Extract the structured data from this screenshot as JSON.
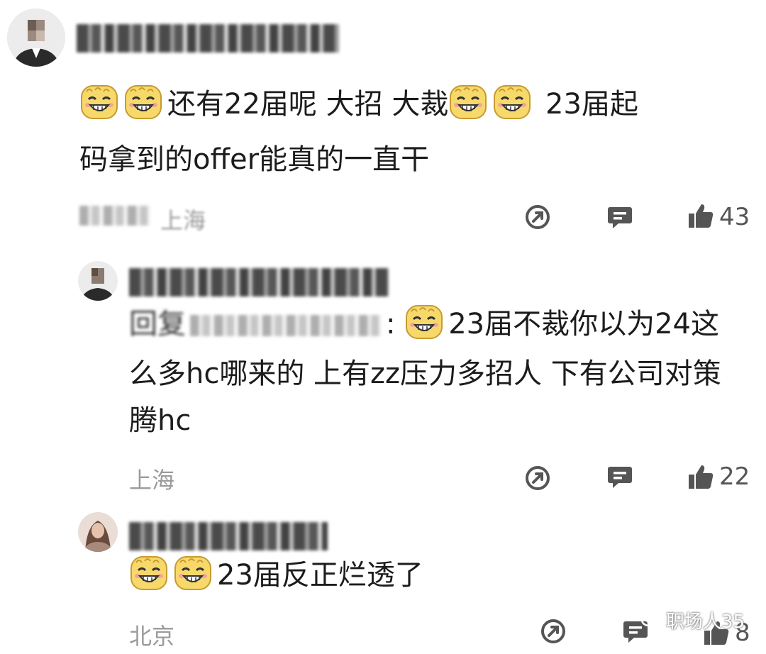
{
  "comments": [
    {
      "username": "",
      "text_a": "还有22届呢 大招 大裁",
      "text_b": "23届起",
      "text_c": "码拿到的offer能真的一直干",
      "location": "上海",
      "likes": "43"
    },
    {
      "username": "",
      "reply_prefix": "回复",
      "text_a": "23届不裁你以为24这",
      "text_b": "么多hc哪来的 上有zz压力多招人 下有公司对策",
      "text_c": "腾hc",
      "location": "上海",
      "likes": "22"
    },
    {
      "username": "",
      "text_a": "23届反正烂透了",
      "location": "北京",
      "likes": "8"
    }
  ],
  "watermark": "职场人35",
  "icons": {
    "share": "share-icon",
    "comment": "comment-icon",
    "like": "thumbs-up-icon",
    "emoji": "grin-emoji-icon"
  },
  "colors": {
    "text": "#1c1c1c",
    "meta": "#9b9b9b",
    "icon": "#555555",
    "emoji_face": "#f7d96b"
  }
}
